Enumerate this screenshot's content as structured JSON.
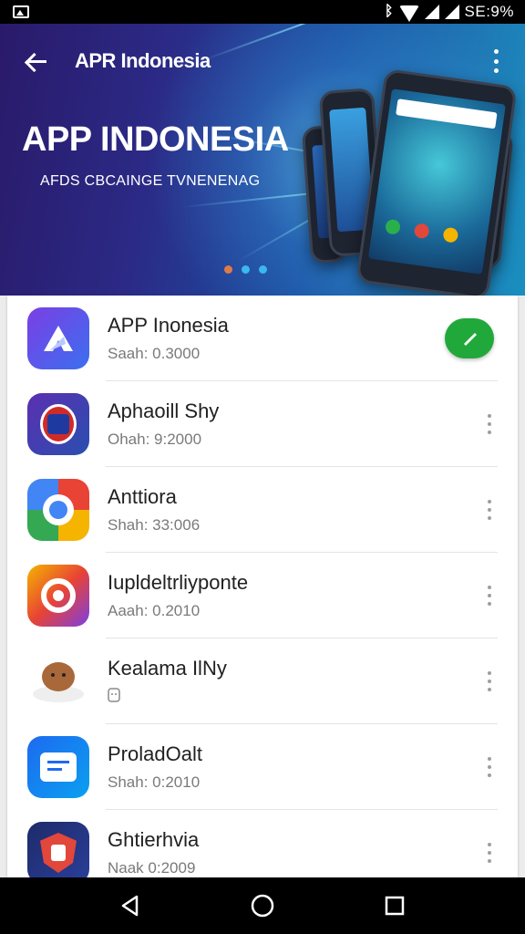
{
  "status_bar": {
    "battery_text": "SE:9%",
    "icons": [
      "image-icon",
      "bluetooth-icon",
      "wifi-icon",
      "signal-icon",
      "signal-icon"
    ]
  },
  "header": {
    "title": "APR Indonesia",
    "back_icon": "arrow-left-icon",
    "more_icon": "more-vert-icon"
  },
  "banner": {
    "title": "APP INDONESIA",
    "subtitle": "AFDS CBCAINGE TVNENENAG",
    "dot_colors": [
      "#e07a4a",
      "#3ab8f0",
      "#3ab8f0"
    ],
    "active_slide": 1,
    "total_slides": 3
  },
  "apps": [
    {
      "name": "APP Inonesia",
      "meta": "Saah: 0.3000",
      "action": "call-button",
      "action_color": "#21a83a"
    },
    {
      "name": "Aphaoill Shy",
      "meta": "Ohah: 9:2000",
      "action": "more"
    },
    {
      "name": "Anttiora",
      "meta": "Shah: 33:006",
      "action": "more"
    },
    {
      "name": "Iupldeltrliyponte",
      "meta": "Aaah: 0.2010",
      "action": "more"
    },
    {
      "name": "Kealama IlNy",
      "meta": "",
      "action": "more"
    },
    {
      "name": "ProladOalt",
      "meta": "Shah: 0:2010",
      "action": "more"
    },
    {
      "name": "Ghtierhvia",
      "meta": "Naak 0:2009",
      "action": "more"
    }
  ],
  "nav": {
    "back": "triangle-back-icon",
    "home": "circle-home-icon",
    "recents": "square-recents-icon"
  }
}
